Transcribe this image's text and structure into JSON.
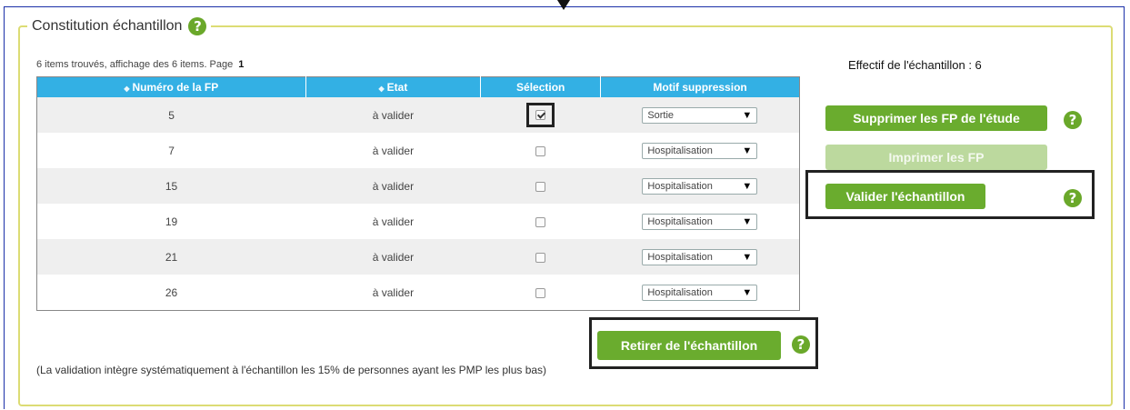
{
  "panel": {
    "title": "Constitution échantillon"
  },
  "list": {
    "info": "6 items trouvés, affichage des 6 items. Page",
    "page": "1"
  },
  "effectif": "Effectif de l'échantillon : 6",
  "table": {
    "headers": {
      "numero": "Numéro de la FP",
      "etat": "Etat",
      "selection": "Sélection",
      "motif": "Motif suppression"
    },
    "rows": [
      {
        "numero": "5",
        "etat": "à valider",
        "selected": true,
        "motif": "Sortie"
      },
      {
        "numero": "7",
        "etat": "à valider",
        "selected": false,
        "motif": "Hospitalisation"
      },
      {
        "numero": "15",
        "etat": "à valider",
        "selected": false,
        "motif": "Hospitalisation"
      },
      {
        "numero": "19",
        "etat": "à valider",
        "selected": false,
        "motif": "Hospitalisation"
      },
      {
        "numero": "21",
        "etat": "à valider",
        "selected": false,
        "motif": "Hospitalisation"
      },
      {
        "numero": "26",
        "etat": "à valider",
        "selected": false,
        "motif": "Hospitalisation"
      }
    ]
  },
  "buttons": {
    "supprimer": "Supprimer les FP de l'étude",
    "imprimer": "Imprimer les FP",
    "valider": "Valider l'échantillon",
    "retirer": "Retirer de l'échantillon"
  },
  "note": "(La validation intègre systématiquement à l'échantillon les 15% de personnes ayant les PMP les plus bas)",
  "icons": {
    "help": "?",
    "dropdown": "▼",
    "sort": "◆"
  },
  "colors": {
    "header": "#33b0e4",
    "button": "#6aac2e",
    "button_disabled": "#bcd99e",
    "panel_border": "#dcdc74",
    "help": "#6aa82a"
  }
}
